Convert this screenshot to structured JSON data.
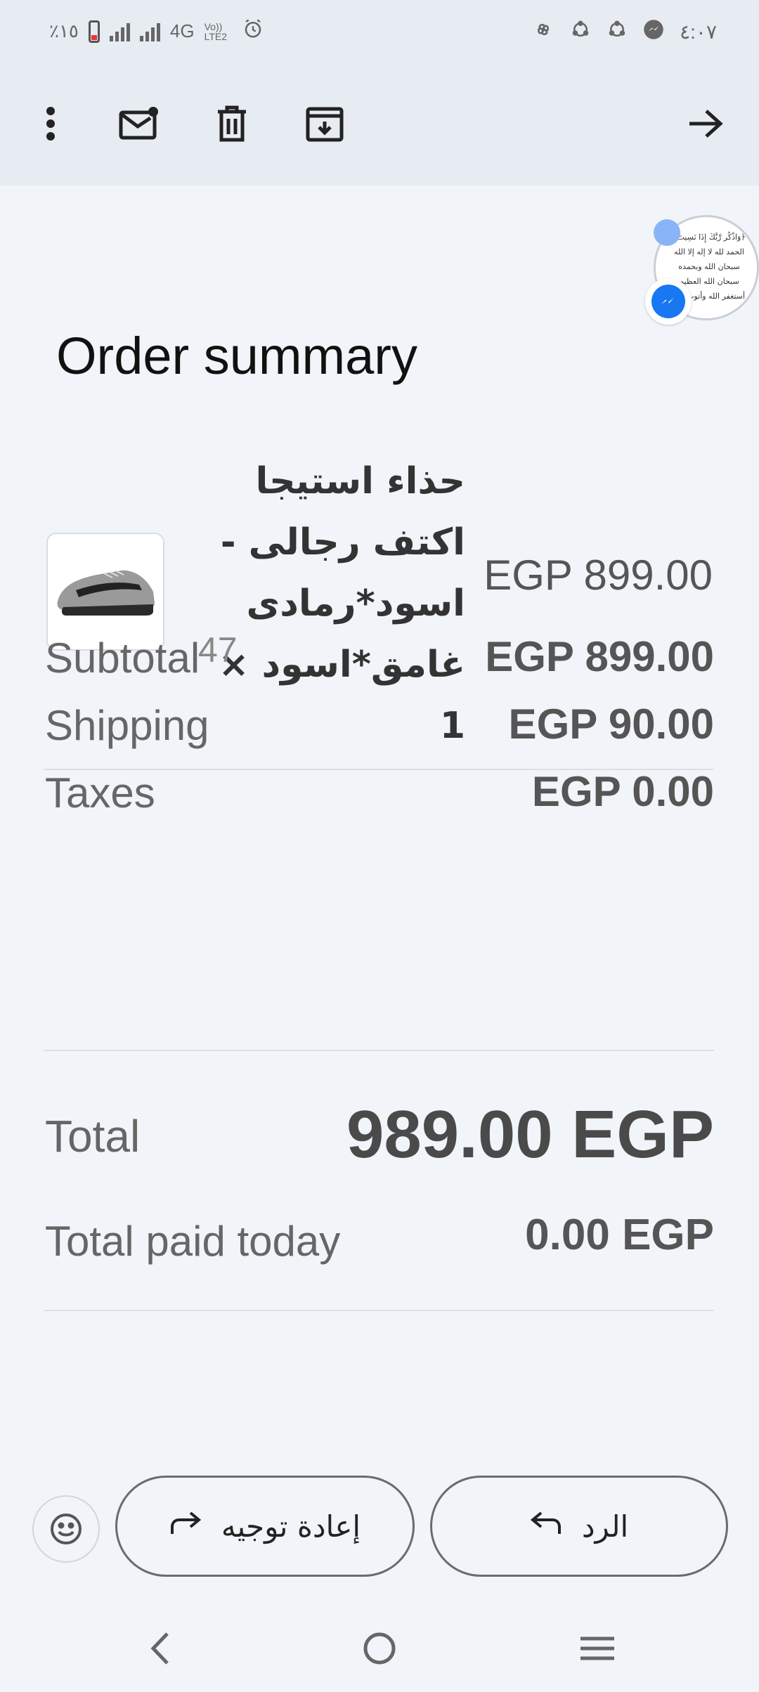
{
  "statusbar": {
    "battery_text": "٪١٥",
    "network_label": "4G",
    "volte_label": "Vo)) LTE2",
    "time": "٤:٠٧"
  },
  "toolbar": {
    "more_icon": "more-vert-icon",
    "unread_icon": "mark-unread-icon",
    "delete_icon": "delete-icon",
    "archive_icon": "archive-icon",
    "forward_nav_icon": "arrow-right-icon"
  },
  "chathead": {
    "text": "﴿وَاذْكُر رَّبَّكَ إِذَا نَسِيتَ﴾ الحمد لله لا إله إلا الله سبحان الله وبحمده سبحان الله العظيم أستغفر الله وأتوب إليه"
  },
  "order": {
    "title": "Order summary",
    "product_name": "حذاء استيجا اكتف رجالى - اسود*رمادى غامق*اسود × 1",
    "product_variant": "47",
    "product_price": "EGP 899.00",
    "subtotal_label": "Subtotal",
    "subtotal_value": "EGP 899.00",
    "shipping_label": "Shipping",
    "shipping_value": "EGP 90.00",
    "taxes_label": "Taxes",
    "taxes_value": "EGP 0.00",
    "total_label": "Total",
    "total_value": "989.00 EGP",
    "paid_label": "Total paid today",
    "paid_value": "0.00 EGP"
  },
  "actions": {
    "forward_label": "إعادة توجيه",
    "reply_label": "الرد"
  },
  "colors": {
    "background": "#f1f4f9",
    "toolbar": "#e7ebf2",
    "messenger": "#1877f2"
  }
}
